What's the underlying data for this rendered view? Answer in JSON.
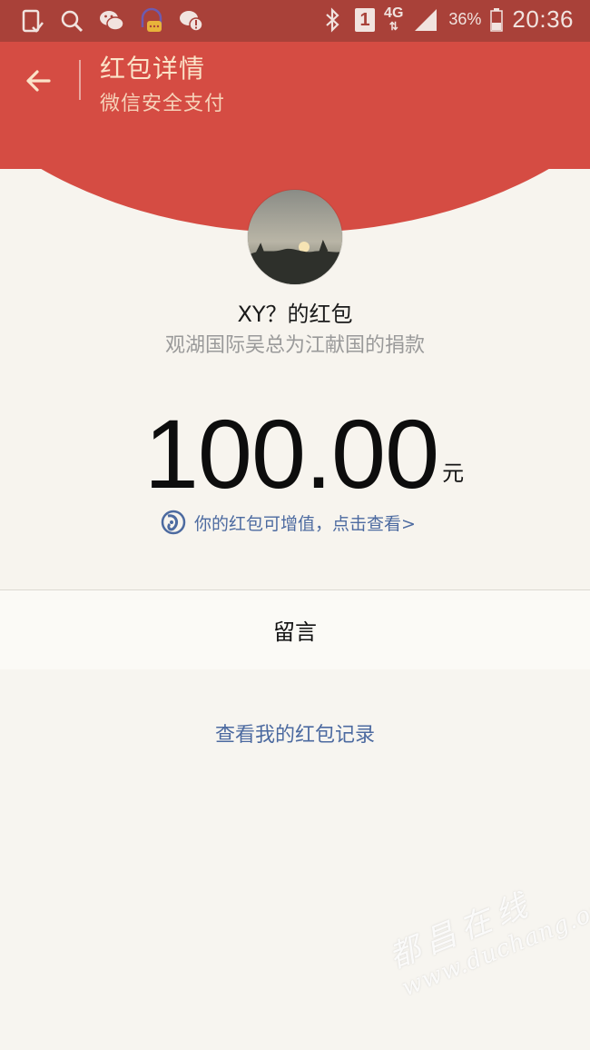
{
  "status_bar": {
    "time": "20:36",
    "battery_percent": "36%",
    "network": "4G",
    "sim_slot": "1",
    "left_icons": [
      "phone-check-icon",
      "search-icon",
      "wechat-icon",
      "chat-app-icon",
      "wechat-alert-icon"
    ],
    "right_icons": [
      "bluetooth-icon",
      "sim-icon",
      "network-4g-icon",
      "signal-icon",
      "battery-icon"
    ]
  },
  "header": {
    "title": "红包详情",
    "subtitle": "微信安全支付",
    "back_icon": "arrow-left-icon",
    "accent_color": "#d54c43",
    "title_color": "#fbe3c8"
  },
  "red_packet": {
    "sender_name": "XY？的红包",
    "greeting": "观湖国际吴总为江献国的捐款",
    "amount": "100.00",
    "amount_unit": "元",
    "upsell_text": "你的红包可增值，点击查看>",
    "upsell_icon": "value-add-icon"
  },
  "message": {
    "label": "留言"
  },
  "records": {
    "link_text": "查看我的红包记录",
    "link_color": "#4c6aa0"
  },
  "watermark": {
    "chinese": "都昌在线",
    "url": "www.duchang.org"
  }
}
